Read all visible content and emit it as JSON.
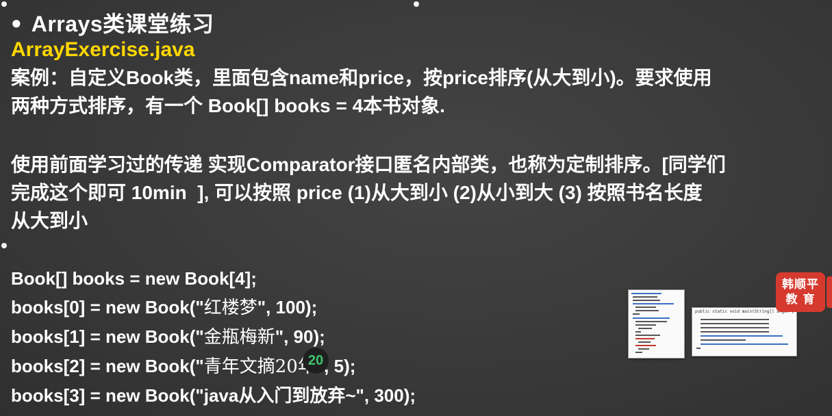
{
  "slide": {
    "bullet": "●",
    "title": "Arrays类课堂练习",
    "filename": "ArrayExercise.java",
    "case_line1": "案例：自定义Book类，里面包含name和price，按price排序(从大到小)。要求使用",
    "case_line2": "两种方式排序，有一个 Book[] books = 4本书对象.",
    "task_line1": "使用前面学习过的传递 实现Comparator接口匿名内部类，也称为定制排序。[同学们",
    "task_line2": "完成这个即可 10min  ], 可以按照 price (1)从大到小 (2)从小到大 (3) 按照书名长度",
    "task_line3": "从大到小"
  },
  "code": {
    "line0": "Book[] books = new Book[4];",
    "books": [
      {
        "prefix": "books[0] = new Book(\"",
        "name": "红楼梦",
        "suffix": "\", 100);"
      },
      {
        "prefix": "books[1] = new Book(\"",
        "name": "金瓶梅新",
        "suffix": "\", 90);"
      },
      {
        "prefix": "books[2] = new Book(\"",
        "name": "青年文摘20年",
        "suffix": "\", 5);"
      },
      {
        "prefix": "books[3] = new Book(\"",
        "name": "java从入门到放弃~",
        "suffix": "\", 300);"
      }
    ]
  },
  "overlay": {
    "timer_value": "20",
    "logo_line1": "韩顺平",
    "logo_line2": "教 育",
    "thumb2_header": "public static void main(String[] args) {"
  },
  "colors": {
    "background": "#3a3a3a",
    "text": "#ffffff",
    "filename": "#ffd700",
    "logo": "#d63a2f",
    "timer_text": "#3ec46d"
  }
}
